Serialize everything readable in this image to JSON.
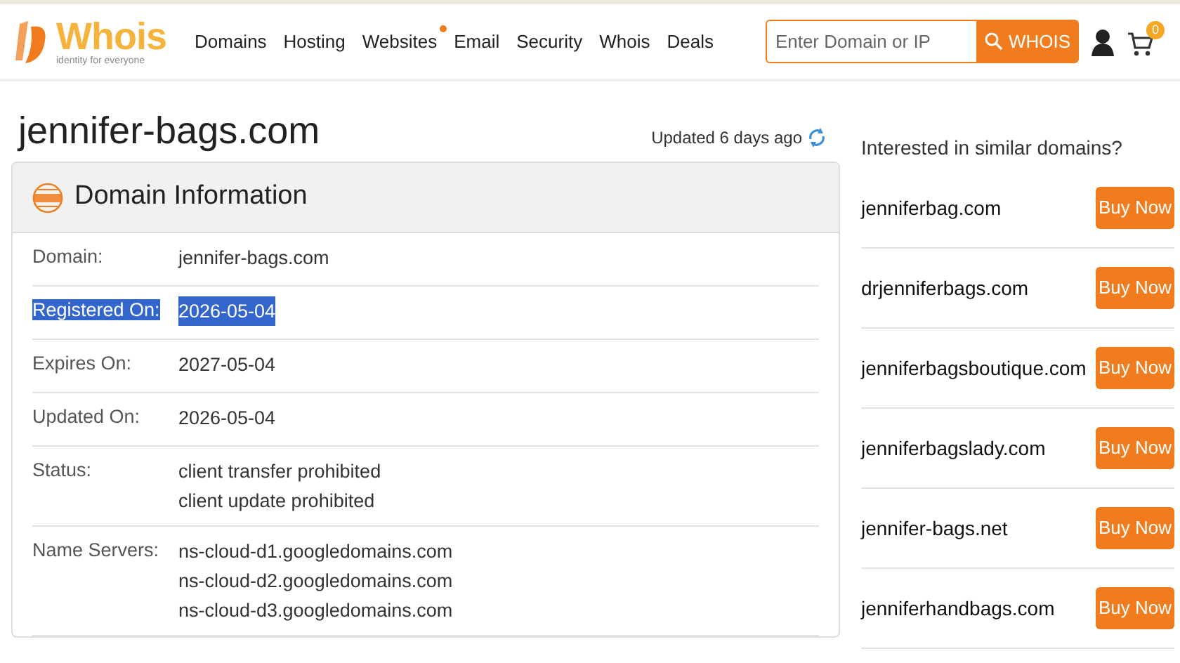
{
  "logo": {
    "name": "Whois",
    "tagline": "identity for everyone"
  },
  "nav": [
    {
      "label": "Domains",
      "dot": false
    },
    {
      "label": "Hosting",
      "dot": false
    },
    {
      "label": "Websites",
      "dot": true
    },
    {
      "label": "Email",
      "dot": false
    },
    {
      "label": "Security",
      "dot": false
    },
    {
      "label": "Whois",
      "dot": false
    },
    {
      "label": "Deals",
      "dot": false
    }
  ],
  "search": {
    "placeholder": "Enter Domain or IP",
    "button": "WHOIS"
  },
  "cart": {
    "count": "0"
  },
  "domain_title": "jennifer-bags.com",
  "updated": "Updated 6 days ago",
  "card": {
    "title": "Domain Information",
    "rows": [
      {
        "label": "Domain:",
        "values": [
          "jennifer-bags.com"
        ],
        "highlighted": false
      },
      {
        "label": "Registered On:",
        "values": [
          "2026-05-04"
        ],
        "highlighted": true
      },
      {
        "label": "Expires On:",
        "values": [
          "2027-05-04"
        ],
        "highlighted": false
      },
      {
        "label": "Updated On:",
        "values": [
          "2026-05-04"
        ],
        "highlighted": false
      },
      {
        "label": "Status:",
        "values": [
          "client transfer prohibited",
          "client update prohibited"
        ],
        "highlighted": false
      },
      {
        "label": "Name Servers:",
        "values": [
          "ns-cloud-d1.googledomains.com",
          "ns-cloud-d2.googledomains.com",
          "ns-cloud-d3.googledomains.com"
        ],
        "highlighted": false
      }
    ]
  },
  "similar": {
    "title": "Interested in similar domains?",
    "items": [
      {
        "domain": "jenniferbag.com",
        "button": "Buy Now"
      },
      {
        "domain": "drjenniferbags.com",
        "button": "Buy Now"
      },
      {
        "domain": "jenniferbagsboutique.com",
        "button": "Buy Now"
      },
      {
        "domain": "jenniferbagslady.com",
        "button": "Buy Now"
      },
      {
        "domain": "jennifer-bags.net",
        "button": "Buy Now"
      },
      {
        "domain": "jenniferhandbags.com",
        "button": "Buy Now"
      }
    ]
  }
}
